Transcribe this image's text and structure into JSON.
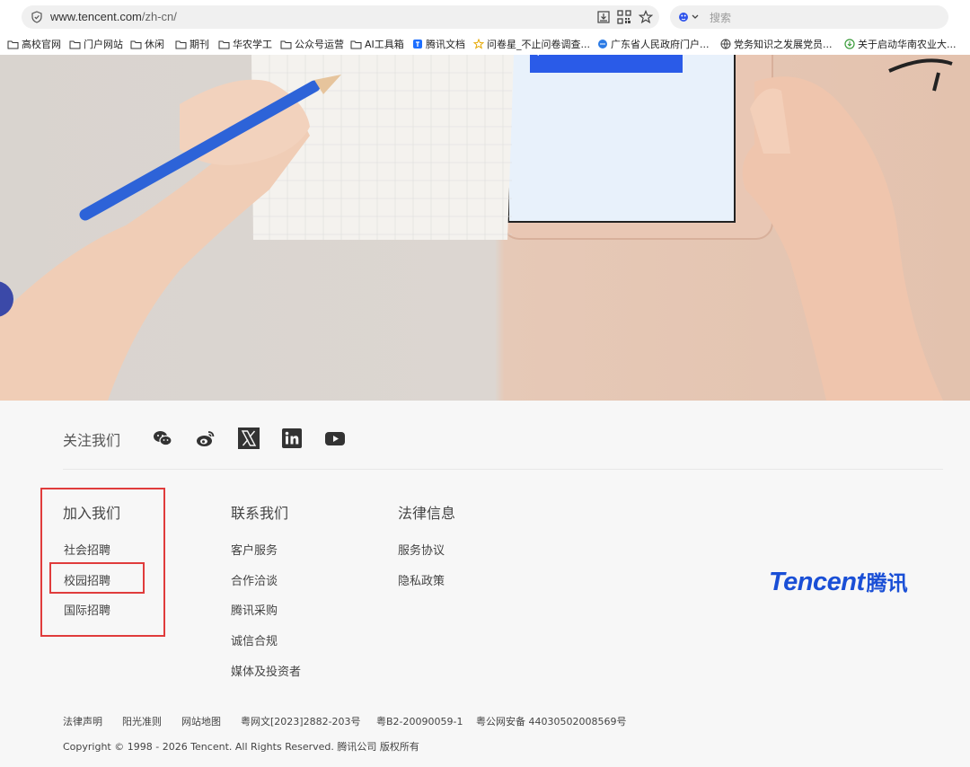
{
  "browser": {
    "url_host": "www.tencent.com",
    "url_path": "/zh-cn/",
    "search_placeholder": "搜索",
    "bookmarks": [
      {
        "label": "高校官网",
        "icon": "folder-icon"
      },
      {
        "label": "门户网站",
        "icon": "folder-icon"
      },
      {
        "label": "休闲",
        "icon": "folder-icon"
      },
      {
        "label": "期刊",
        "icon": "folder-icon"
      },
      {
        "label": "华农学工",
        "icon": "folder-icon"
      },
      {
        "label": "公众号运营",
        "icon": "folder-icon"
      },
      {
        "label": "AI工具箱",
        "icon": "folder-icon"
      },
      {
        "label": "腾讯文档",
        "icon": "tencent-docs-icon"
      },
      {
        "label": "问卷星_不止问卷调查...",
        "icon": "star-icon"
      },
      {
        "label": "广东省人民政府门户...",
        "icon": "gd-gov-icon"
      },
      {
        "label": "党务知识之发展党员...",
        "icon": "globe-icon"
      },
      {
        "label": "关于启动华南农业大...",
        "icon": "download-circle-icon"
      }
    ]
  },
  "footer": {
    "follow_label": "关注我们",
    "social": [
      "wechat-icon",
      "weibo-icon",
      "x-icon",
      "linkedin-icon",
      "youtube-icon"
    ],
    "columns": [
      {
        "title": "加入我们",
        "links": [
          "社会招聘",
          "校园招聘",
          "国际招聘"
        ]
      },
      {
        "title": "联系我们",
        "links": [
          "客户服务",
          "合作洽谈",
          "腾讯采购",
          "诚信合规",
          "媒体及投资者"
        ]
      },
      {
        "title": "法律信息",
        "links": [
          "服务协议",
          "隐私政策"
        ]
      }
    ],
    "logo_text": "Tencent",
    "logo_cn": "腾讯",
    "legal_links": [
      "法律声明",
      "阳光准则",
      "网站地图",
      "粤网文[2023]2882-203号",
      "粤B2-20090059-1",
      "粤公网安备 44030502008569号"
    ],
    "copyright": "Copyright © 1998 - 2026 Tencent. All Rights Reserved. 腾讯公司 版权所有"
  },
  "colors": {
    "brand_blue": "#1a4fd6",
    "highlight_red": "#e03c3c"
  }
}
